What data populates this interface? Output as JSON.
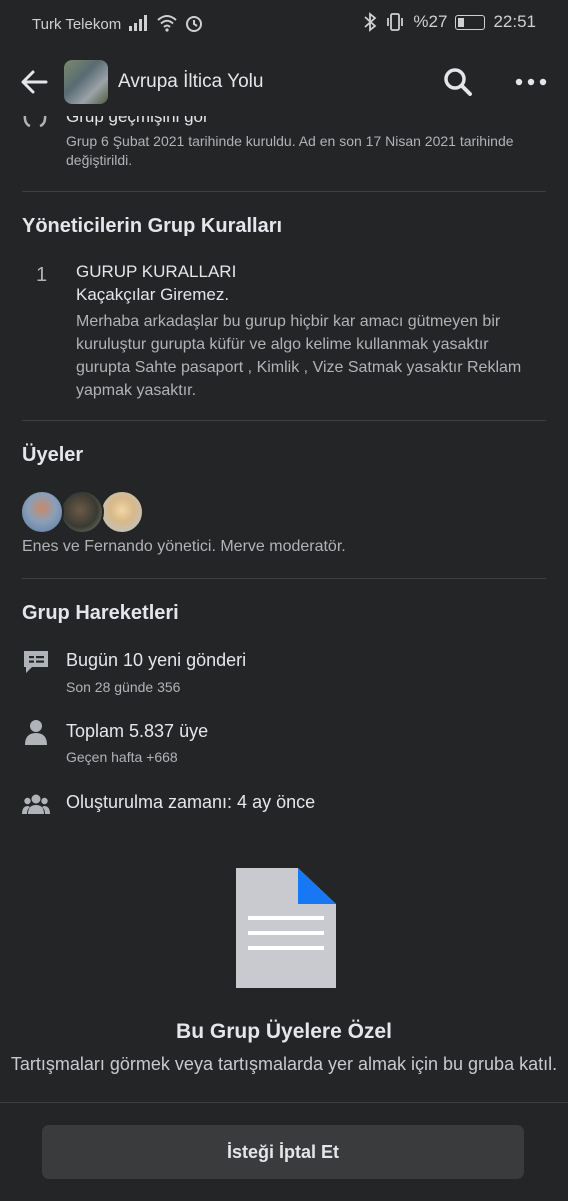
{
  "status_bar": {
    "carrier": "Turk Telekom",
    "battery": "%27",
    "time": "22:51"
  },
  "app_bar": {
    "title": "Avrupa İltica Yolu"
  },
  "history": {
    "title_partial": "Grup geçmişini gör",
    "description": "Grup 6 Şubat 2021 tarihinde kuruldu. Ad en son 17 Nisan 2021 tarihinde değiştirildi."
  },
  "rules": {
    "heading": "Yöneticilerin Grup Kuralları",
    "items": [
      {
        "number": "1",
        "title_line1": "GURUP KURALLARI",
        "title_line2": "Kaçakçılar Giremez.",
        "body": "Merhaba arkadaşlar bu gurup hiçbir kar amacı gütmeyen bir kuruluştur gurupta küfür ve algo kelime kullanmak yasaktır gurupta Sahte pasaport , Kimlik , Vize Satmak yasaktır Reklam yapmak yasaktır."
      }
    ]
  },
  "members": {
    "heading": "Üyeler",
    "admins_text": "Enes ve Fernando yönetici. Merve moderatör."
  },
  "activity": {
    "heading": "Grup Hareketleri",
    "posts_main": "Bugün 10 yeni gönderi",
    "posts_sub": "Son 28 günde 356",
    "members_main": "Toplam 5.837 üye",
    "members_sub": "Geçen hafta +668",
    "created": "Oluşturulma zamanı: 4 ay önce"
  },
  "private": {
    "title": "Bu Grup Üyelere Özel",
    "description": "Tartışmaları görmek veya tartışmalarda yer almak için bu gruba katıl."
  },
  "bottom": {
    "cancel_label": "İsteği İptal Et"
  },
  "colors": {
    "background": "#242526",
    "text_primary": "#e4e6eb",
    "text_secondary": "#b0b3b8",
    "button_bg": "#3a3b3c",
    "doc_accent": "#1877f2"
  }
}
